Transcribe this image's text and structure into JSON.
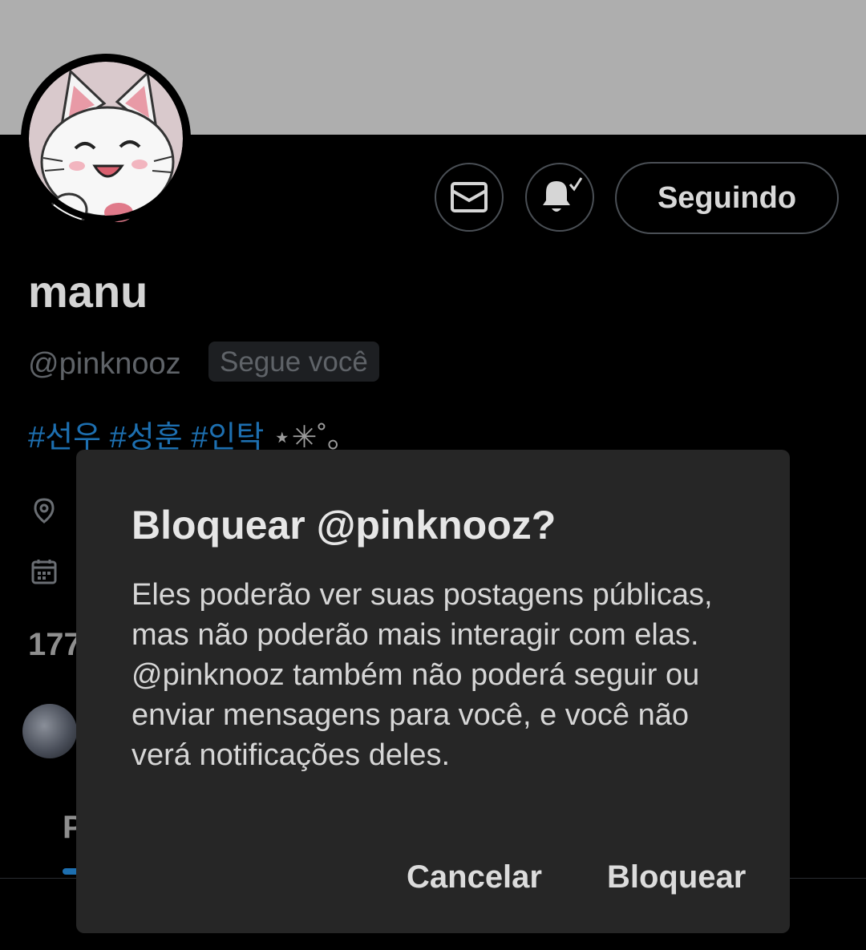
{
  "profile": {
    "name": "manu",
    "handle": "@pinknooz",
    "follows_you": "Segue você",
    "bio_tags": "#선우 #성훈 #인탁",
    "bio_deco": " ⋆✳︎˚｡",
    "following_count_partial": "177",
    "tab_partial": "P",
    "follow_button": "Seguindo"
  },
  "icons": {
    "message": "envelope-icon",
    "notifications": "bell-check-icon",
    "location": "location-pin-icon",
    "calendar": "calendar-icon"
  },
  "dialog": {
    "title": "Bloquear @pinknooz?",
    "body": "Eles poderão ver suas postagens públicas, mas não poderão mais interagir com elas. @pinknooz também não poderá seguir ou enviar mensagens para você, e você não verá notificações deles.",
    "cancel": "Cancelar",
    "confirm": "Bloquear"
  },
  "colors": {
    "banner": "#aeaeae",
    "background": "#000000",
    "dialog": "#262626",
    "link": "#1d6fb0"
  }
}
